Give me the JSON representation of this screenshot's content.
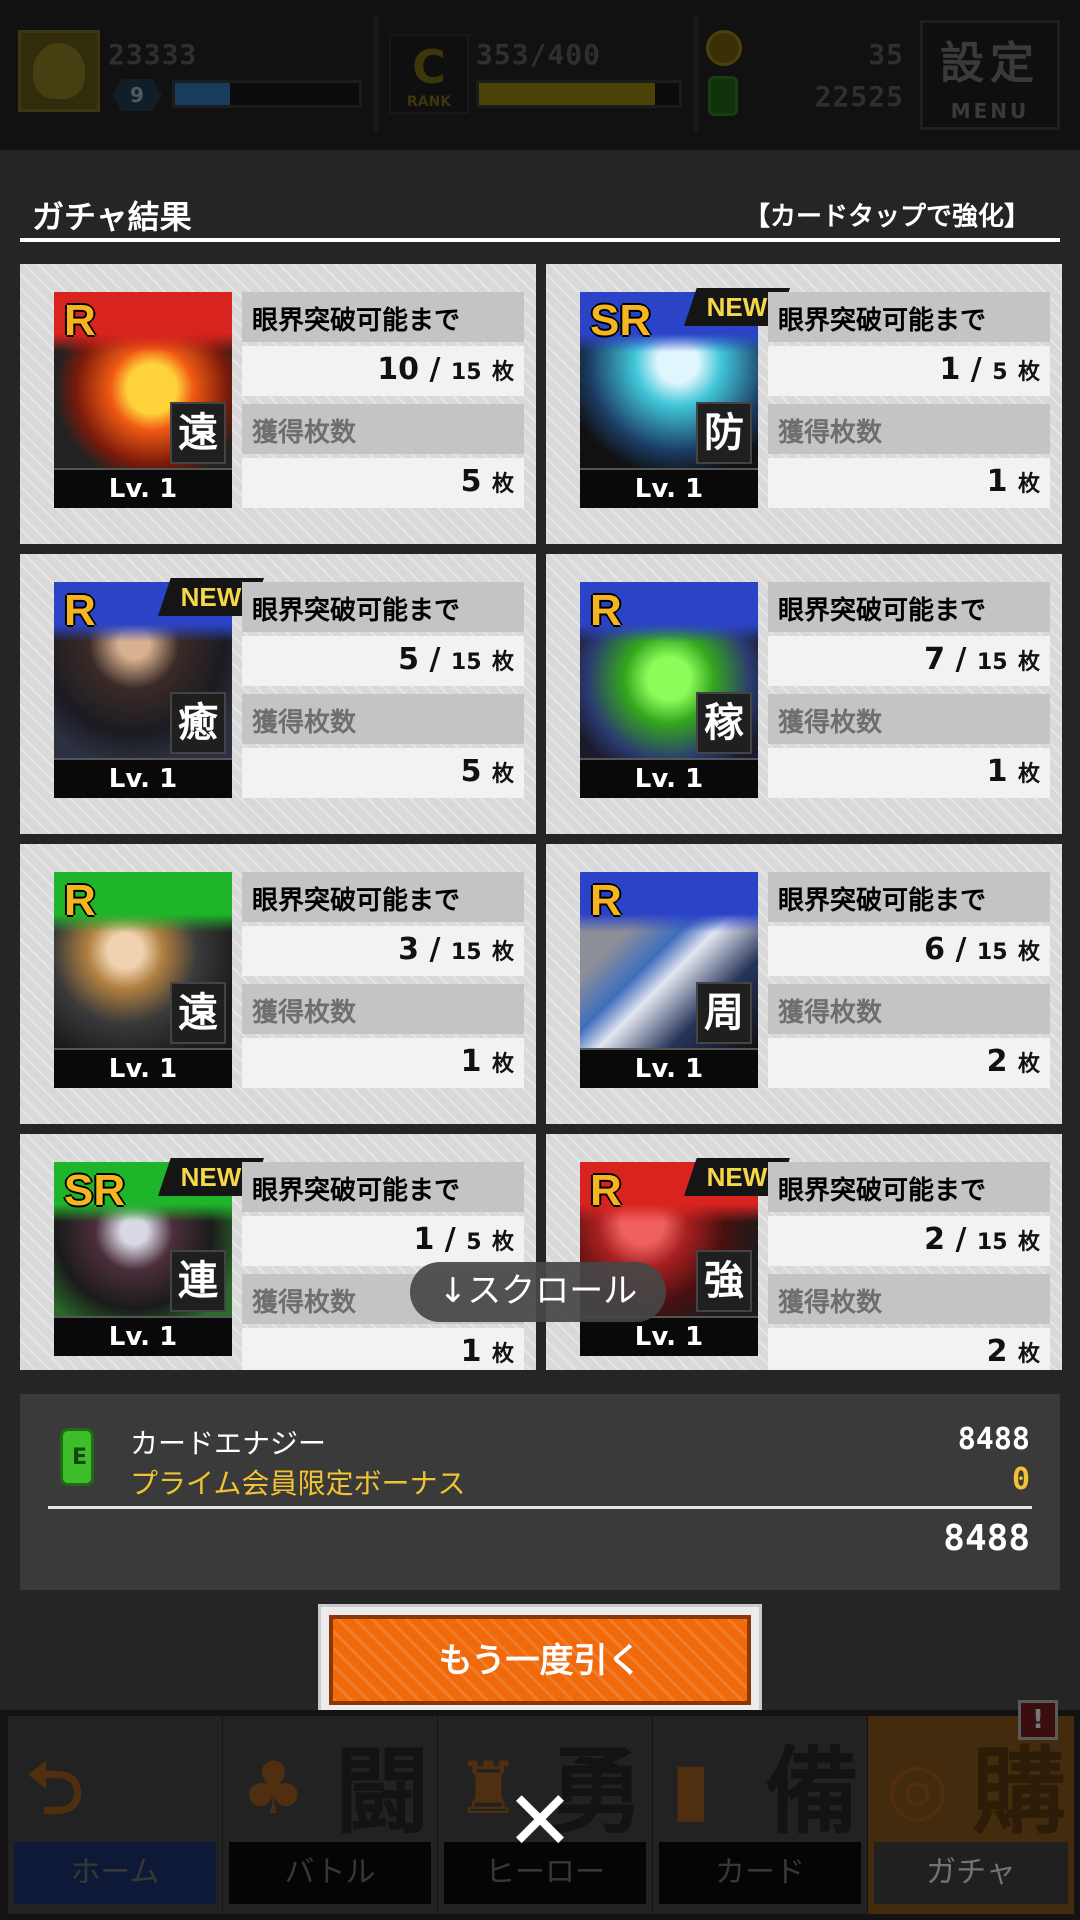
{
  "topbar": {
    "exp": "23333",
    "level": "9",
    "rank_progress": "353/400",
    "rank_letter": "C",
    "rank_label": "RANK",
    "coins": "35",
    "energy": "22525",
    "menu_kanji": "設定",
    "menu_label": "MENU",
    "exp_fill_fraction": 0.3,
    "rank_fill_fraction": 0.88
  },
  "result": {
    "title": "ガチャ結果",
    "hint": "【カードタップで強化】"
  },
  "labels": {
    "limit": "眼界突破可能まで",
    "obtained": "獲得枚数",
    "unit": "枚",
    "new": "NEW",
    "level": "Lv. 1"
  },
  "cards": [
    {
      "rarity": "R",
      "role": "遠",
      "limit_current": "10",
      "limit_max": "15",
      "obtained": "5",
      "new": false,
      "frame_color": "#d8231f"
    },
    {
      "rarity": "SR",
      "role": "防",
      "limit_current": "1",
      "limit_max": "5",
      "obtained": "1",
      "new": true,
      "frame_color": "#2b44c7"
    },
    {
      "rarity": "R",
      "role": "癒",
      "limit_current": "5",
      "limit_max": "15",
      "obtained": "5",
      "new": true,
      "frame_color": "#2b44c7"
    },
    {
      "rarity": "R",
      "role": "稼",
      "limit_current": "7",
      "limit_max": "15",
      "obtained": "1",
      "new": false,
      "frame_color": "#2b44c7"
    },
    {
      "rarity": "R",
      "role": "遠",
      "limit_current": "3",
      "limit_max": "15",
      "obtained": "1",
      "new": false,
      "frame_color": "#1fb52a"
    },
    {
      "rarity": "R",
      "role": "周",
      "limit_current": "6",
      "limit_max": "15",
      "obtained": "2",
      "new": false,
      "frame_color": "#2b44c7"
    },
    {
      "rarity": "SR",
      "role": "連",
      "limit_current": "1",
      "limit_max": "5",
      "obtained": "1",
      "new": true,
      "frame_color": "#1fb52a"
    },
    {
      "rarity": "R",
      "role": "強",
      "limit_current": "2",
      "limit_max": "15",
      "obtained": "2",
      "new": true,
      "frame_color": "#d8231f"
    }
  ],
  "scroll_hint": "↓スクロール",
  "energy_summary": {
    "label": "カードエナジー",
    "value": "8488",
    "bonus_label": "プライム会員限定ボーナス",
    "bonus_value": "0",
    "total": "8488"
  },
  "again_button": "もう一度引く",
  "bottom_nav": [
    {
      "kanji": "",
      "label": "ホーム",
      "icon": "back-arrow-icon"
    },
    {
      "kanji": "闘",
      "label": "バトル",
      "icon": "gamepad-icon"
    },
    {
      "kanji": "勇",
      "label": "ヒーロー",
      "icon": "hero-icon"
    },
    {
      "kanji": "備",
      "label": "カード",
      "icon": "cards-icon"
    },
    {
      "kanji": "購",
      "label": "ガチャ",
      "icon": "gacha-icon"
    }
  ],
  "alert_mark": "!",
  "close_mark": "✕",
  "colors": {
    "accent_orange": "#f06a0c",
    "gold": "#f1c232",
    "energy_green": "#3fbe2c"
  }
}
